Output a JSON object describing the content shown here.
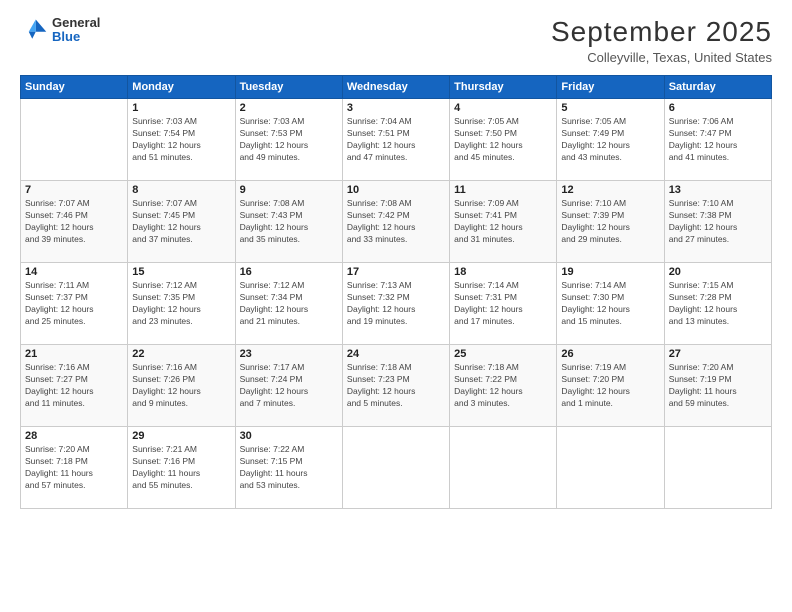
{
  "logo": {
    "general": "General",
    "blue": "Blue"
  },
  "header": {
    "title": "September 2025",
    "subtitle": "Colleyville, Texas, United States"
  },
  "columns": [
    "Sunday",
    "Monday",
    "Tuesday",
    "Wednesday",
    "Thursday",
    "Friday",
    "Saturday"
  ],
  "weeks": [
    [
      {
        "day": "",
        "info": ""
      },
      {
        "day": "1",
        "info": "Sunrise: 7:03 AM\nSunset: 7:54 PM\nDaylight: 12 hours\nand 51 minutes."
      },
      {
        "day": "2",
        "info": "Sunrise: 7:03 AM\nSunset: 7:53 PM\nDaylight: 12 hours\nand 49 minutes."
      },
      {
        "day": "3",
        "info": "Sunrise: 7:04 AM\nSunset: 7:51 PM\nDaylight: 12 hours\nand 47 minutes."
      },
      {
        "day": "4",
        "info": "Sunrise: 7:05 AM\nSunset: 7:50 PM\nDaylight: 12 hours\nand 45 minutes."
      },
      {
        "day": "5",
        "info": "Sunrise: 7:05 AM\nSunset: 7:49 PM\nDaylight: 12 hours\nand 43 minutes."
      },
      {
        "day": "6",
        "info": "Sunrise: 7:06 AM\nSunset: 7:47 PM\nDaylight: 12 hours\nand 41 minutes."
      }
    ],
    [
      {
        "day": "7",
        "info": "Sunrise: 7:07 AM\nSunset: 7:46 PM\nDaylight: 12 hours\nand 39 minutes."
      },
      {
        "day": "8",
        "info": "Sunrise: 7:07 AM\nSunset: 7:45 PM\nDaylight: 12 hours\nand 37 minutes."
      },
      {
        "day": "9",
        "info": "Sunrise: 7:08 AM\nSunset: 7:43 PM\nDaylight: 12 hours\nand 35 minutes."
      },
      {
        "day": "10",
        "info": "Sunrise: 7:08 AM\nSunset: 7:42 PM\nDaylight: 12 hours\nand 33 minutes."
      },
      {
        "day": "11",
        "info": "Sunrise: 7:09 AM\nSunset: 7:41 PM\nDaylight: 12 hours\nand 31 minutes."
      },
      {
        "day": "12",
        "info": "Sunrise: 7:10 AM\nSunset: 7:39 PM\nDaylight: 12 hours\nand 29 minutes."
      },
      {
        "day": "13",
        "info": "Sunrise: 7:10 AM\nSunset: 7:38 PM\nDaylight: 12 hours\nand 27 minutes."
      }
    ],
    [
      {
        "day": "14",
        "info": "Sunrise: 7:11 AM\nSunset: 7:37 PM\nDaylight: 12 hours\nand 25 minutes."
      },
      {
        "day": "15",
        "info": "Sunrise: 7:12 AM\nSunset: 7:35 PM\nDaylight: 12 hours\nand 23 minutes."
      },
      {
        "day": "16",
        "info": "Sunrise: 7:12 AM\nSunset: 7:34 PM\nDaylight: 12 hours\nand 21 minutes."
      },
      {
        "day": "17",
        "info": "Sunrise: 7:13 AM\nSunset: 7:32 PM\nDaylight: 12 hours\nand 19 minutes."
      },
      {
        "day": "18",
        "info": "Sunrise: 7:14 AM\nSunset: 7:31 PM\nDaylight: 12 hours\nand 17 minutes."
      },
      {
        "day": "19",
        "info": "Sunrise: 7:14 AM\nSunset: 7:30 PM\nDaylight: 12 hours\nand 15 minutes."
      },
      {
        "day": "20",
        "info": "Sunrise: 7:15 AM\nSunset: 7:28 PM\nDaylight: 12 hours\nand 13 minutes."
      }
    ],
    [
      {
        "day": "21",
        "info": "Sunrise: 7:16 AM\nSunset: 7:27 PM\nDaylight: 12 hours\nand 11 minutes."
      },
      {
        "day": "22",
        "info": "Sunrise: 7:16 AM\nSunset: 7:26 PM\nDaylight: 12 hours\nand 9 minutes."
      },
      {
        "day": "23",
        "info": "Sunrise: 7:17 AM\nSunset: 7:24 PM\nDaylight: 12 hours\nand 7 minutes."
      },
      {
        "day": "24",
        "info": "Sunrise: 7:18 AM\nSunset: 7:23 PM\nDaylight: 12 hours\nand 5 minutes."
      },
      {
        "day": "25",
        "info": "Sunrise: 7:18 AM\nSunset: 7:22 PM\nDaylight: 12 hours\nand 3 minutes."
      },
      {
        "day": "26",
        "info": "Sunrise: 7:19 AM\nSunset: 7:20 PM\nDaylight: 12 hours\nand 1 minute."
      },
      {
        "day": "27",
        "info": "Sunrise: 7:20 AM\nSunset: 7:19 PM\nDaylight: 11 hours\nand 59 minutes."
      }
    ],
    [
      {
        "day": "28",
        "info": "Sunrise: 7:20 AM\nSunset: 7:18 PM\nDaylight: 11 hours\nand 57 minutes."
      },
      {
        "day": "29",
        "info": "Sunrise: 7:21 AM\nSunset: 7:16 PM\nDaylight: 11 hours\nand 55 minutes."
      },
      {
        "day": "30",
        "info": "Sunrise: 7:22 AM\nSunset: 7:15 PM\nDaylight: 11 hours\nand 53 minutes."
      },
      {
        "day": "",
        "info": ""
      },
      {
        "day": "",
        "info": ""
      },
      {
        "day": "",
        "info": ""
      },
      {
        "day": "",
        "info": ""
      }
    ]
  ]
}
